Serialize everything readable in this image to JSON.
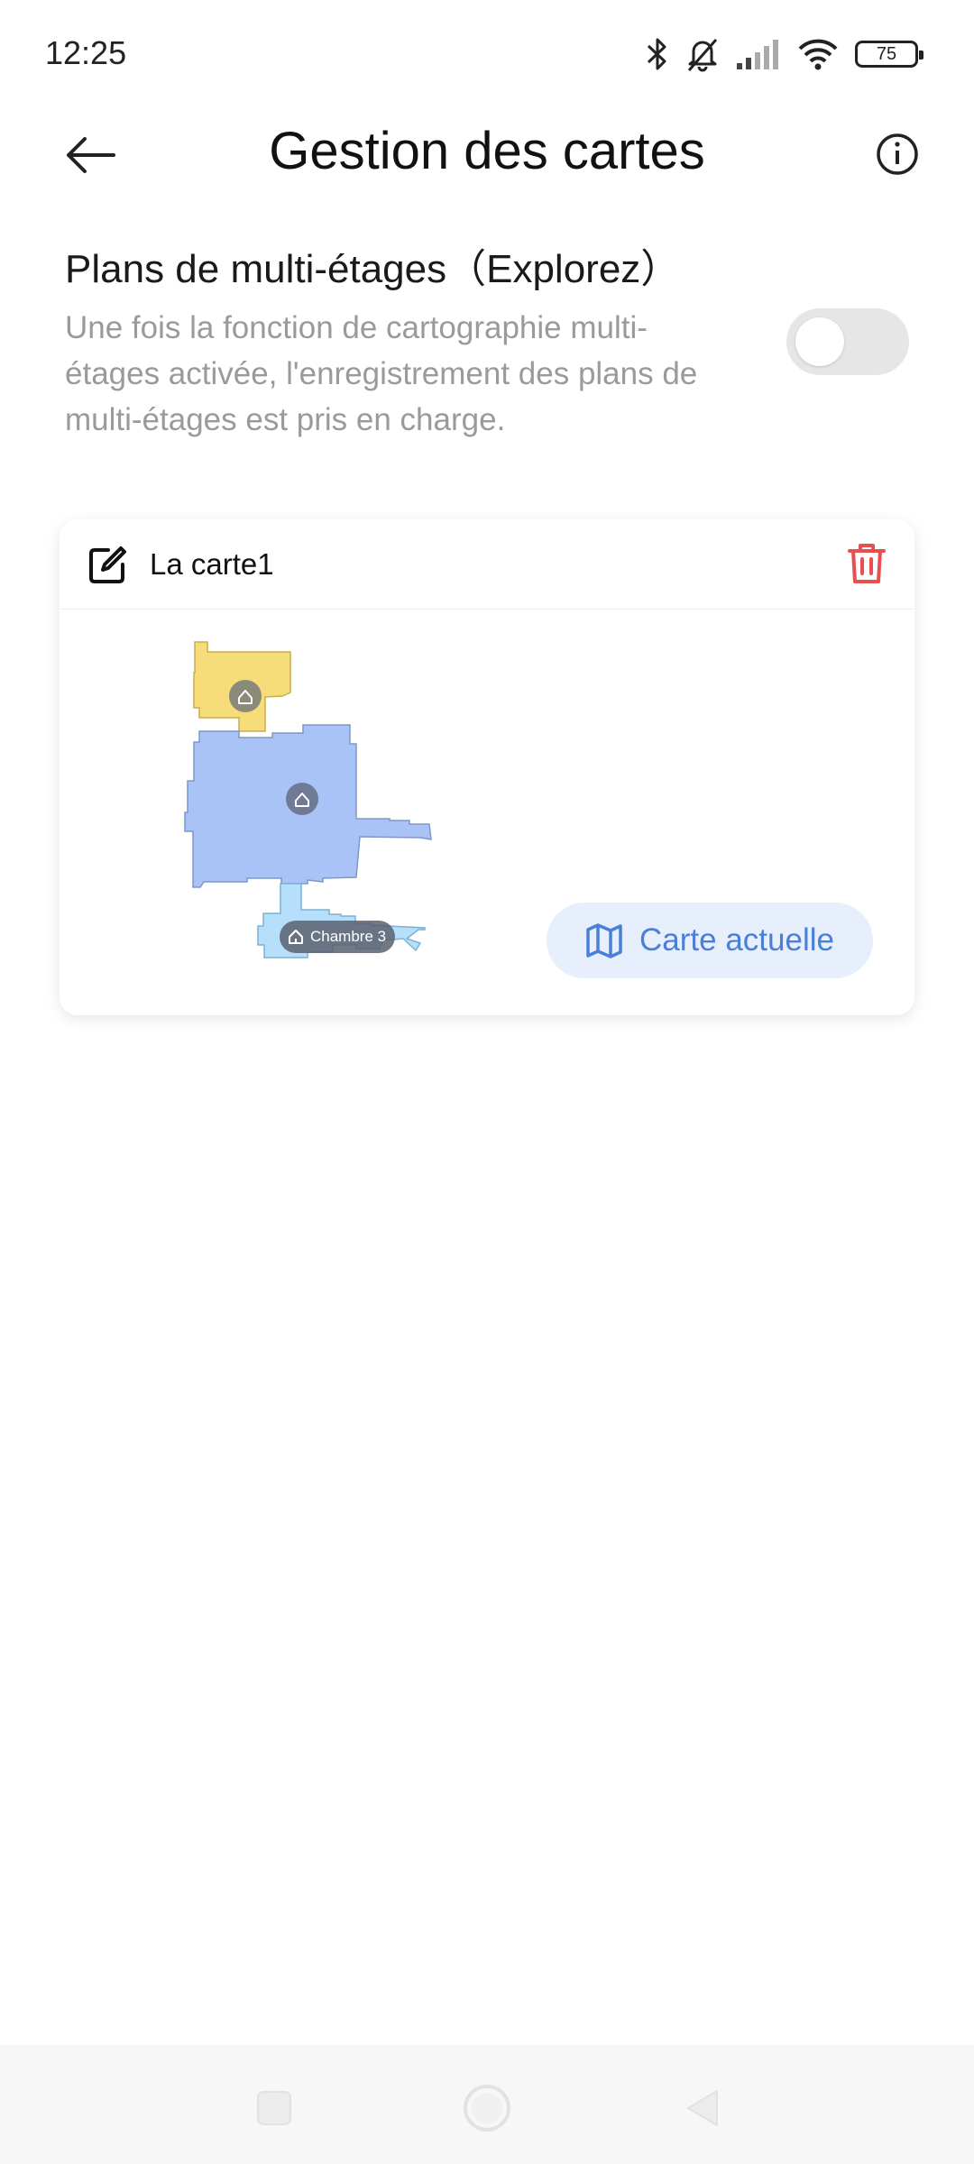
{
  "status_bar": {
    "time": "12:25",
    "battery": "75",
    "icons": [
      "bluetooth-icon",
      "bell-muted-icon",
      "signal-icon",
      "wifi-icon",
      "battery-icon"
    ]
  },
  "header": {
    "title": "Gestion des cartes",
    "back_icon": "arrow-left-icon",
    "info_icon": "info-icon"
  },
  "multi_floor": {
    "title": "Plans de multi-étages（Explorez）",
    "description": "Une fois la fonction de cartographie multi-étages activée, l'enregistrement des plans de multi-étages est pris en charge.",
    "toggle_on": false
  },
  "map_card": {
    "name": "La carte1",
    "edit_icon": "edit-icon",
    "delete_icon": "trash-icon",
    "room_label": "Chambre 3",
    "current_map_label": "Carte actuelle",
    "current_map_icon": "map-icon",
    "colors": {
      "room_yellow": "#f7dc7a",
      "room_blue": "#aac3f7",
      "room_lightblue": "#b5dffa",
      "accent": "#4a7fd8",
      "delete_red": "#e85050"
    }
  },
  "nav_bar": {
    "icons": [
      "recents-icon",
      "home-icon",
      "back-icon"
    ]
  }
}
